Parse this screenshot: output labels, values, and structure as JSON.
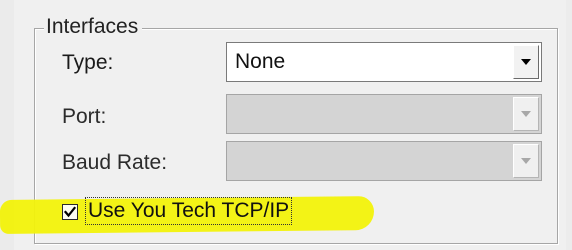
{
  "group": {
    "title": "Interfaces"
  },
  "fields": {
    "type": {
      "label": "Type:",
      "value": "None",
      "enabled": true
    },
    "port": {
      "label": "Port:",
      "value": "",
      "enabled": false
    },
    "baud_rate": {
      "label": "Baud Rate:",
      "value": "",
      "enabled": false
    }
  },
  "tcp_option": {
    "label": "Use You Tech TCP/IP",
    "checked": true,
    "highlight_color": "#f2f20a"
  },
  "icons": {
    "dropdown": "chevron-down-icon",
    "check": "checkmark-icon"
  }
}
